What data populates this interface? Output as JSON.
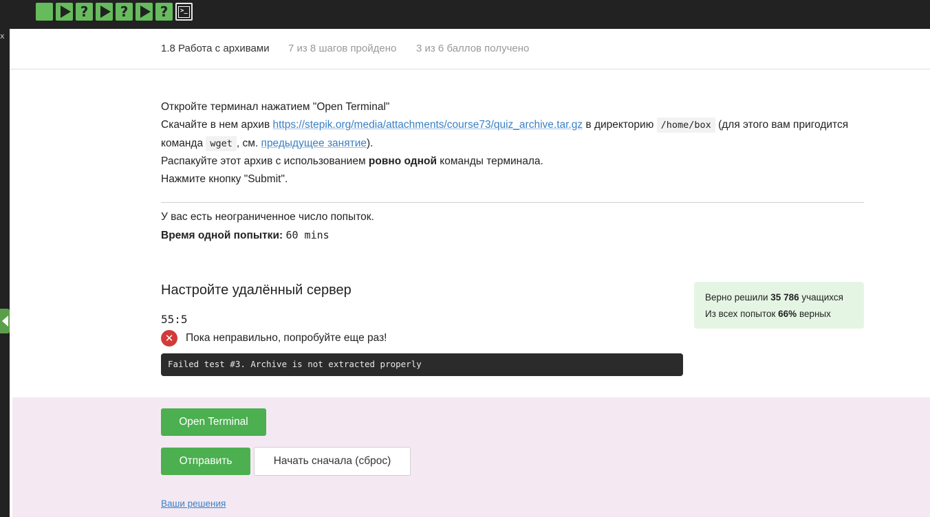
{
  "steps": [
    {
      "type": "text"
    },
    {
      "type": "video"
    },
    {
      "type": "quiz",
      "glyph": "?"
    },
    {
      "type": "video"
    },
    {
      "type": "quiz",
      "glyph": "?"
    },
    {
      "type": "video"
    },
    {
      "type": "quiz",
      "glyph": "?"
    },
    {
      "type": "terminal",
      "glyph": ">_"
    }
  ],
  "left_rail": {
    "close_glyph": "x"
  },
  "header": {
    "title": "1.8 Работа с архивами",
    "progress": "7 из 8 шагов пройдено",
    "score": "3 из 6 баллов  получено"
  },
  "task": {
    "line1": "Откройте терминал нажатием \"Open Terminal\"",
    "line2_prefix": "Скачайте в нем архив ",
    "archive_link": "https://stepik.org/media/attachments/course73/quiz_archive.tar.gz",
    "line2_mid": " в директорию ",
    "dir_code": "/home/box",
    "line2_suffix": " (для этого вам пригодится команда ",
    "wget_code": "wget",
    "line2_see": ", см. ",
    "prev_link": "предыдущее занятие",
    "line2_end": ").",
    "line3_prefix": "Распакуйте этот архив с использованием ",
    "line3_bold": "ровно одной",
    "line3_suffix": " команды терминала.",
    "line4": "Нажмите кнопку \"Submit\"."
  },
  "attempts": {
    "unlimited": "У вас есть неограниченное число попыток.",
    "time_label": "Время одной попытки:",
    "time_value": "60 mins"
  },
  "quiz": {
    "title": "Настройте удалённый сервер",
    "timer": "55:5",
    "status_icon": "error-x",
    "status_text": "Пока неправильно, попробуйте еще раз!",
    "feedback": "Failed test #3. Archive is not extracted properly"
  },
  "stats": {
    "solved_prefix": "Верно решили ",
    "solved_count": "35 786",
    "solved_suffix": " учащихся",
    "rate_prefix": "Из всех попыток ",
    "rate_value": "66%",
    "rate_suffix": " верных"
  },
  "actions": {
    "open_terminal": "Open Terminal",
    "submit": "Отправить",
    "reset": "Начать сначала (сброс)",
    "solutions": "Ваши решения"
  },
  "colors": {
    "accent_green": "#4caf50",
    "step_green": "#66bb5c",
    "error_red": "#d33a3a",
    "link_blue": "#3a7fc4",
    "stats_bg": "#e5f5e4",
    "actions_bg": "#f4e9f3"
  }
}
